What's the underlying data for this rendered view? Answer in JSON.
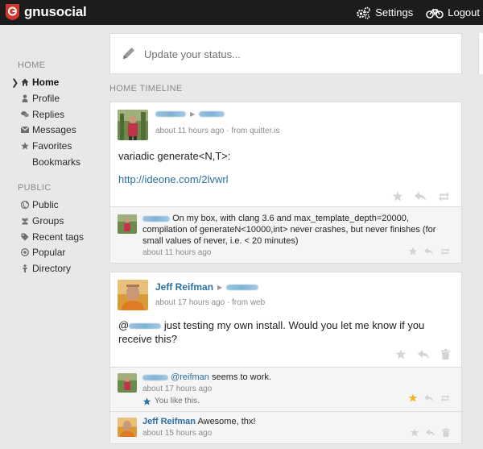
{
  "header": {
    "brand": "gnusocial",
    "nav": [
      {
        "label": "Settings",
        "icon": "gears-icon"
      },
      {
        "label": "Logout",
        "icon": "bicycle-icon"
      }
    ]
  },
  "sidebar": {
    "home_heading": "HOME",
    "home_items": [
      {
        "label": "Home",
        "icon": "home-icon",
        "active": true
      },
      {
        "label": "Profile",
        "icon": "person-icon"
      },
      {
        "label": "Replies",
        "icon": "chat-bubbles-icon"
      },
      {
        "label": "Messages",
        "icon": "envelope-icon"
      },
      {
        "label": "Favorites",
        "icon": "star-icon"
      },
      {
        "label": "Bookmarks",
        "icon": ""
      }
    ],
    "public_heading": "PUBLIC",
    "public_items": [
      {
        "label": "Public",
        "icon": "globe-icon"
      },
      {
        "label": "Groups",
        "icon": "group-icon"
      },
      {
        "label": "Recent tags",
        "icon": "tags-icon"
      },
      {
        "label": "Popular",
        "icon": "popular-icon"
      },
      {
        "label": "Directory",
        "icon": "directory-icon"
      }
    ]
  },
  "status": {
    "placeholder": "Update your status..."
  },
  "timeline": {
    "heading": "HOME TIMELINE",
    "notices": [
      {
        "author": "",
        "meta": "about 11 hours ago",
        "source": "· from quitter.is",
        "text": "variadic generate<N,T>:",
        "link": "http://ideone.com/2lvwrl",
        "replies": [
          {
            "author": "",
            "text": "On my box, with clang 3.6 and max_template_depth=20000, compilation of generateN<10000,int> never crashes, but never finishes (for small values of never, i.e. < 20 minutes)",
            "meta": "about 11 hours ago"
          }
        ]
      },
      {
        "author": "Jeff Reifman",
        "meta": "about 17 hours ago",
        "source": "· from web",
        "text_prefix": "@",
        "text": "just testing my own install. Would you let me know if you receive this?",
        "replies": [
          {
            "author": "",
            "mention": "@reifman",
            "text": "seems to work.",
            "meta": "about 17 hours ago",
            "liked": "You like this."
          },
          {
            "author": "Jeff Reifman",
            "text": "Awesome, thx!",
            "meta": "about 15 hours ago"
          }
        ]
      }
    ]
  },
  "colors": {
    "topbar": "#1c1c1c",
    "link": "#2a6fa1",
    "brand_red": "#d2362d",
    "favorited_star": "#f0b429"
  }
}
